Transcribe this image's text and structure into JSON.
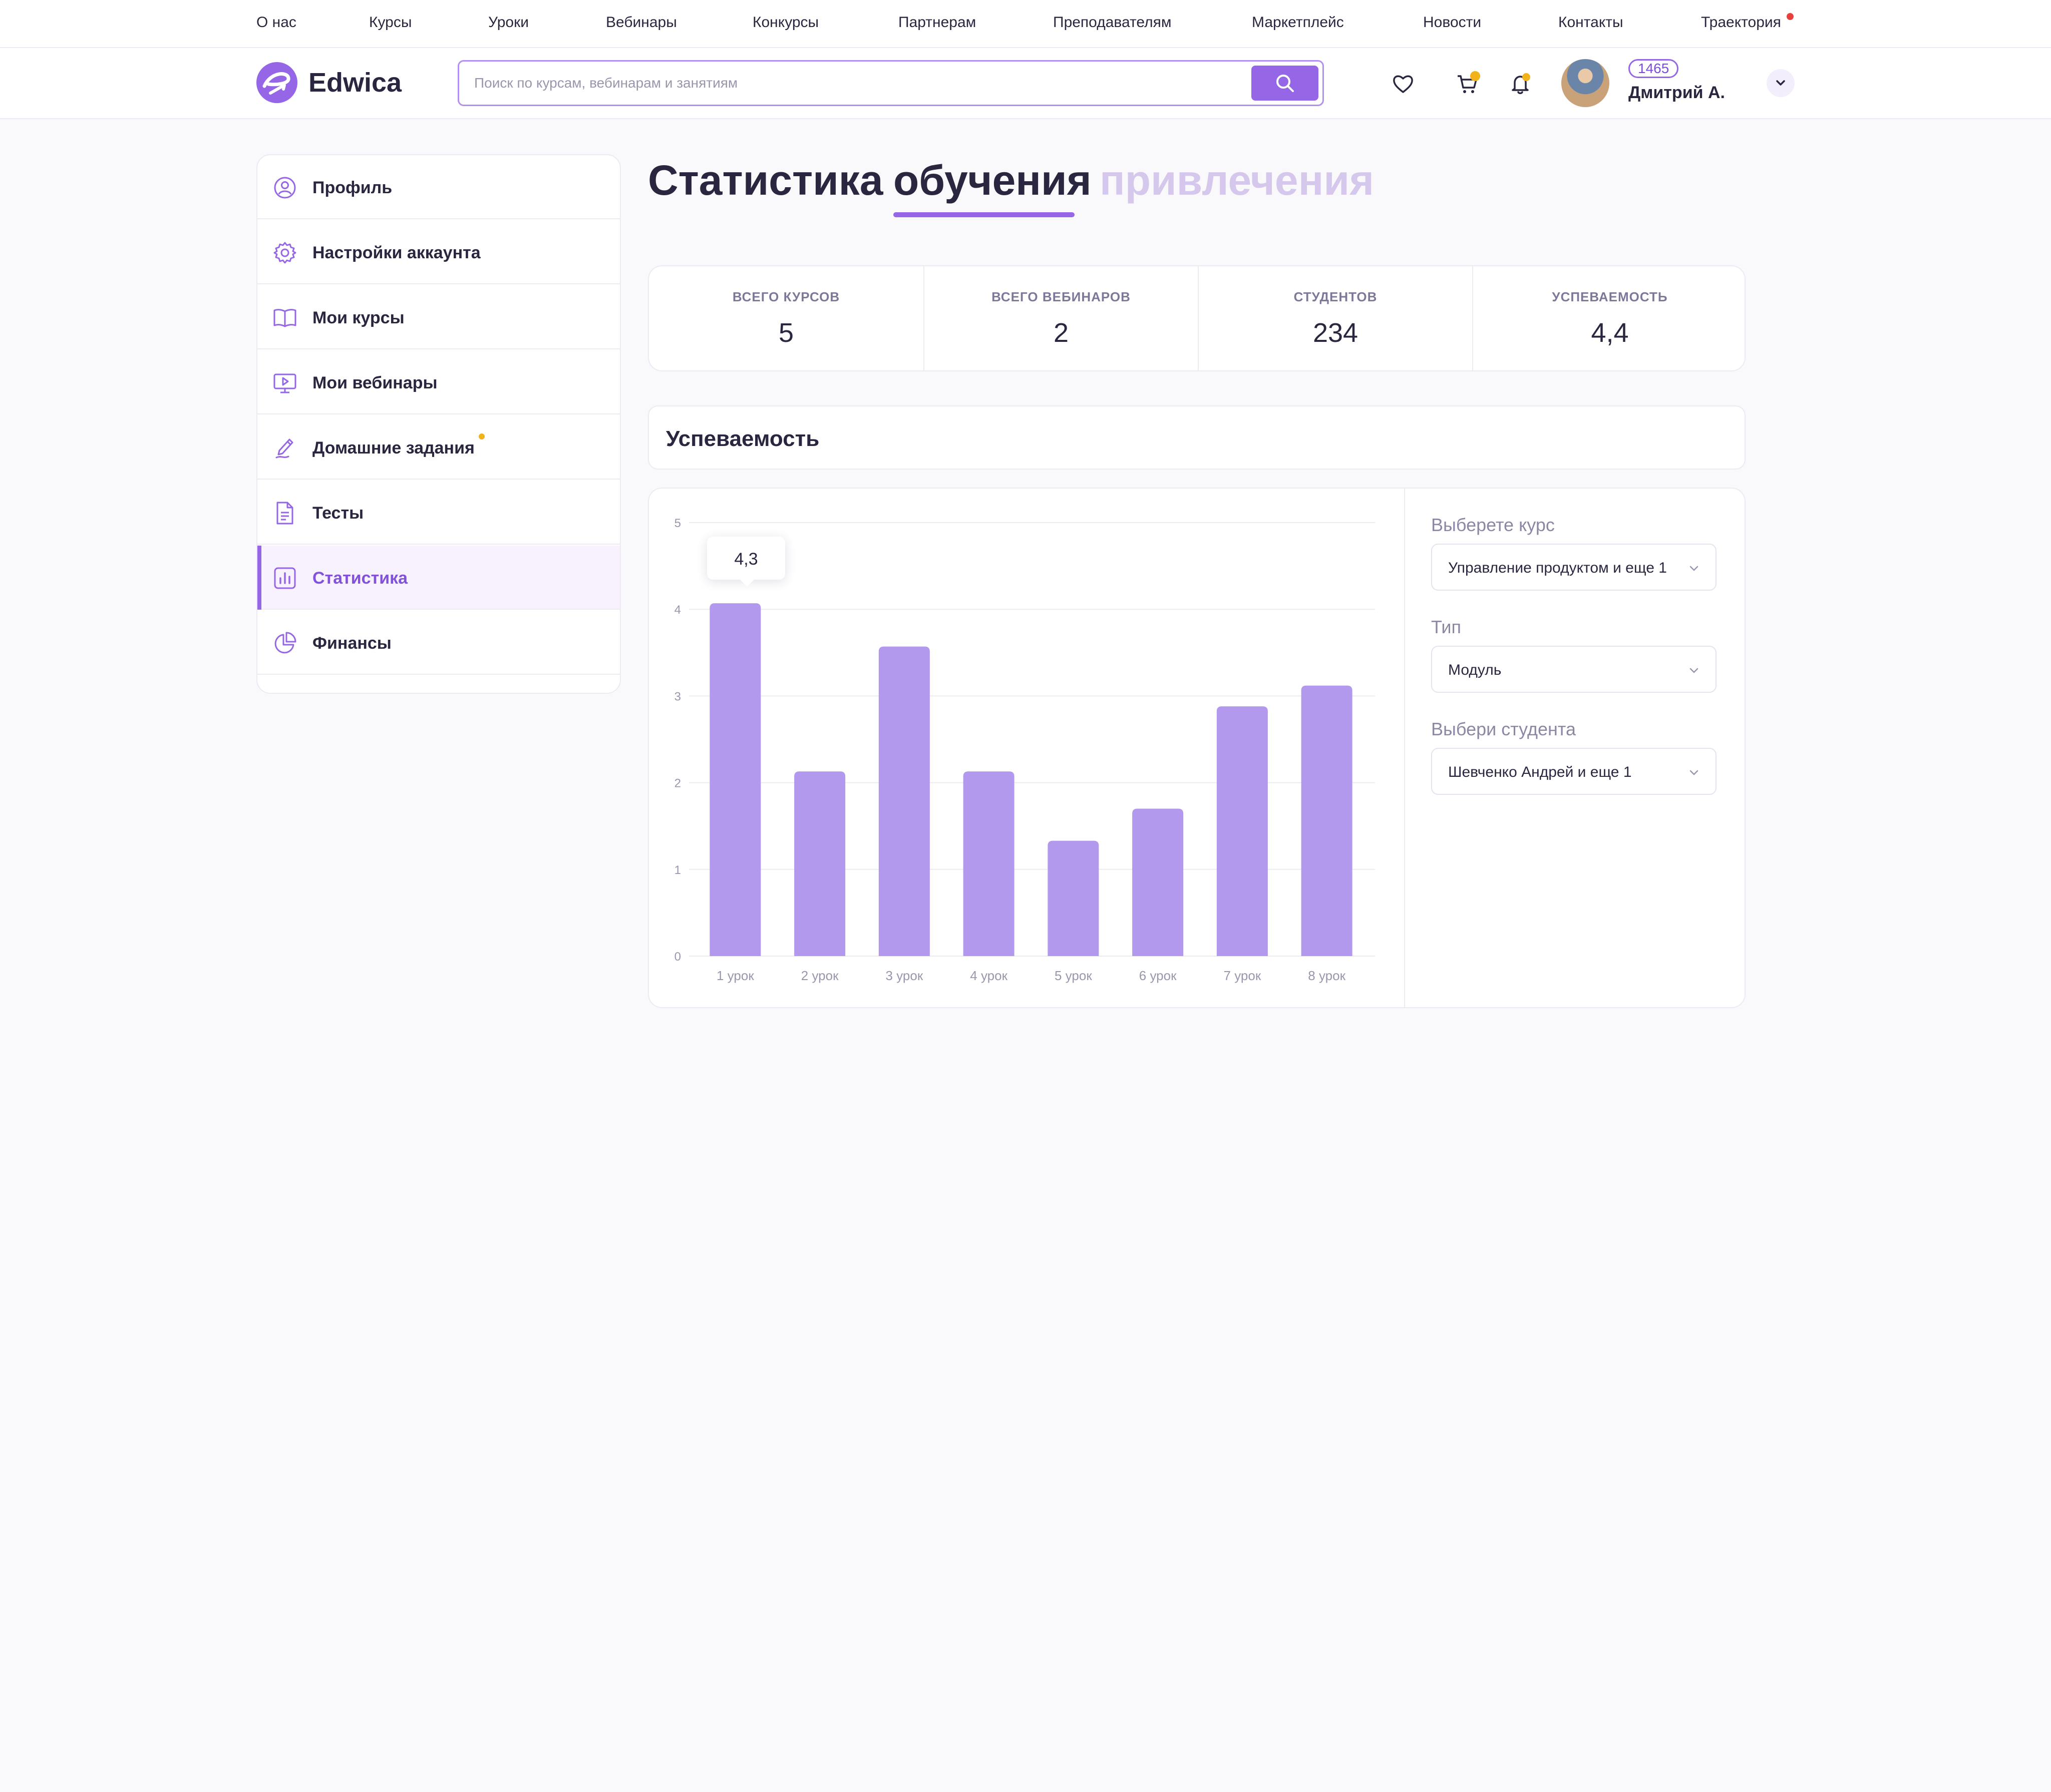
{
  "topnav": {
    "items": [
      "О нас",
      "Курсы",
      "Уроки",
      "Вебинары",
      "Конкурсы",
      "Партнерам",
      "Преподавателям",
      "Маркетплейс",
      "Новости",
      "Контакты",
      "Траектория"
    ]
  },
  "header": {
    "brand": "Edwica",
    "search_placeholder": "Поиск по курсам, вебинарам и занятиям",
    "points": "1465",
    "username": "Дмитрий А."
  },
  "sidebar": {
    "items": [
      {
        "label": "Профиль",
        "icon": "user-circle-icon"
      },
      {
        "label": "Настройки аккаунта",
        "icon": "gear-icon"
      },
      {
        "label": "Мои курсы",
        "icon": "book-icon"
      },
      {
        "label": "Мои вебинары",
        "icon": "video-screen-icon"
      },
      {
        "label": "Домашние задания",
        "icon": "pen-icon"
      },
      {
        "label": "Тесты",
        "icon": "document-icon"
      },
      {
        "label": "Статистика",
        "icon": "bar-chart-icon"
      },
      {
        "label": "Финансы",
        "icon": "pie-chart-icon"
      }
    ],
    "active_index": 6
  },
  "page": {
    "title": "Статистика",
    "tabs": [
      "обучения",
      "привлечения"
    ],
    "active_tab": 0
  },
  "stats": [
    {
      "caption": "ВСЕГО КУРСОВ",
      "value": "5"
    },
    {
      "caption": "ВСЕГО ВЕБИНАРОВ",
      "value": "2"
    },
    {
      "caption": "СТУДЕНТОВ",
      "value": "234"
    },
    {
      "caption": "УСПЕВАЕМОСТЬ",
      "value": "4,4"
    }
  ],
  "section_title": "Успеваемость",
  "filters": [
    {
      "label": "Выберете курс",
      "value": "Управление продуктом и еще 1"
    },
    {
      "label": "Тип",
      "value": "Модуль"
    },
    {
      "label": "Выбери студента",
      "value": "Шевченко Андрей и еще 1"
    }
  ],
  "tooltip": "4,3",
  "colors": {
    "accent": "#9566e6",
    "bar": "#b399ee",
    "text_dark": "#2a2640",
    "muted": "#8d87a6",
    "notification_red": "#e8413c",
    "badge_yellow": "#f2b21c"
  },
  "chart_data": {
    "type": "bar",
    "categories": [
      "1 урок",
      "2 урок",
      "3 урок",
      "4 урок",
      "5 урок",
      "6 урок",
      "7 урок",
      "8 урок"
    ],
    "values": [
      4.07,
      2.13,
      3.57,
      2.13,
      1.33,
      1.7,
      2.88,
      3.12
    ],
    "ylim": [
      0,
      5
    ],
    "yticks": [
      "0",
      "1",
      "2",
      "3",
      "4",
      "5"
    ],
    "grid": true,
    "highlighted_index": 0
  }
}
